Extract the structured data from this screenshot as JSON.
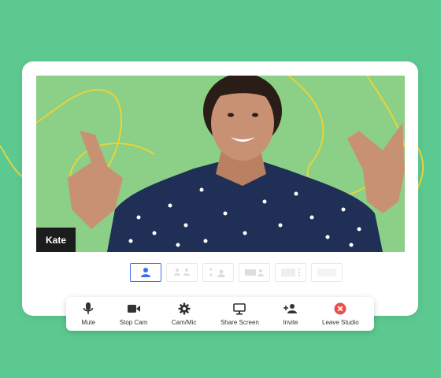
{
  "participant": {
    "name": "Kate"
  },
  "layout_options": [
    {
      "name": "layout-solo",
      "active": true
    },
    {
      "name": "layout-grid-2",
      "active": false
    },
    {
      "name": "layout-grid-4",
      "active": false
    },
    {
      "name": "layout-side",
      "active": false
    },
    {
      "name": "layout-spotlight",
      "active": false
    },
    {
      "name": "layout-empty",
      "active": false
    }
  ],
  "toolbar": {
    "mute_label": "Mute",
    "stop_cam_label": "Stop Cam",
    "cam_mic_label": "Cam/Mic",
    "share_screen_label": "Share Screen",
    "invite_label": "Invite",
    "leave_label": "Leave Studio"
  },
  "colors": {
    "page_background": "#5cc990",
    "video_background": "#8ccf86",
    "accent_blue": "#3a6ee8",
    "leave_red": "#e8504a",
    "curve_yellow": "#e7d43a"
  }
}
